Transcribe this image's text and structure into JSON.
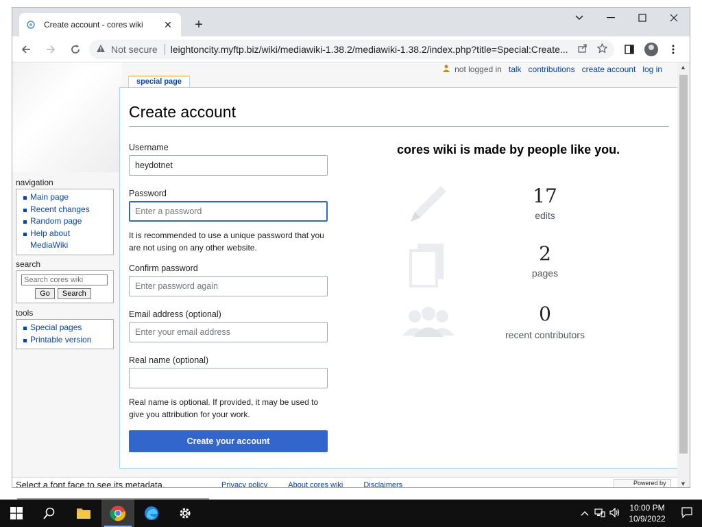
{
  "browser": {
    "tab_title": "Create account - cores wiki",
    "new_tab_symbol": "+",
    "close_symbol": "✕",
    "not_secure": "Not secure",
    "url": "leightoncity.myftp.biz/wiki/mediawiki-1.38.2/mediawiki-1.38.2/index.php?title=Special:Create..."
  },
  "personal": {
    "not_logged_in": "not logged in",
    "talk": "talk",
    "contributions": "contributions",
    "create_account": "create account",
    "log_in": "log in"
  },
  "sidebar": {
    "navigation_title": "navigation",
    "navigation_items": [
      "Main page",
      "Recent changes",
      "Random page",
      "Help about",
      "MediaWiki"
    ],
    "search_title": "search",
    "search_placeholder": "Search cores wiki",
    "go_label": "Go",
    "search_label": "Search",
    "tools_title": "tools",
    "tools_items": [
      "Special pages",
      "Printable version"
    ]
  },
  "page": {
    "tab_label": "special page",
    "title": "Create account"
  },
  "form": {
    "username_label": "Username",
    "username_value": "heydotnet",
    "password_label": "Password",
    "password_placeholder": "Enter a password",
    "password_hint": "It is recommended to use a unique password that you are not using on any other website.",
    "confirm_label": "Confirm password",
    "confirm_placeholder": "Enter password again",
    "email_label": "Email address (optional)",
    "email_placeholder": "Enter your email address",
    "realname_label": "Real name (optional)",
    "realname_value": "",
    "realname_hint": "Real name is optional. If provided, it may be used to give you attribution for your work.",
    "submit_label": "Create your account"
  },
  "benefits": {
    "heading": "cores wiki is made by people like you.",
    "items": [
      {
        "number": "17",
        "label": "edits",
        "icon": "pencil-icon"
      },
      {
        "number": "2",
        "label": "pages",
        "icon": "pages-icon"
      },
      {
        "number": "0",
        "label": "recent contributors",
        "icon": "users-icon"
      }
    ]
  },
  "footer": {
    "overlay_text": "Select a font face to see its metadata.",
    "privacy": "Privacy policy",
    "about": "About cores wiki",
    "disclaimers": "Disclaimers",
    "powered_by": "Powered by"
  },
  "taskbar": {
    "time": "10:00 PM",
    "date": "10/9/2022"
  },
  "colors": {
    "link": "#0645ad",
    "accent": "#3366cc",
    "taskbar": "#101010"
  }
}
